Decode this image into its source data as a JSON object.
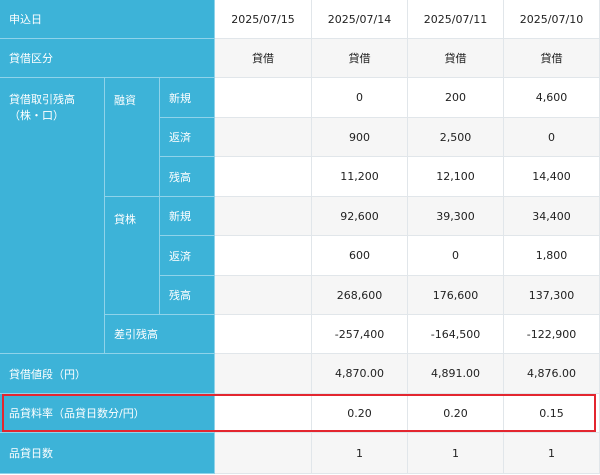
{
  "header": {
    "label": "申込日",
    "dates": [
      "2025/07/15",
      "2025/07/14",
      "2025/07/11",
      "2025/07/10"
    ]
  },
  "rows": {
    "kubun": {
      "label": "貸借区分",
      "values": [
        "貸借",
        "貸借",
        "貸借",
        "貸借"
      ]
    },
    "group_label": "貸借取引残高\n（株・口）",
    "yushi": {
      "label": "融資",
      "shinki": {
        "label": "新規",
        "values": [
          "",
          "0",
          "200",
          "4,600"
        ]
      },
      "hensai": {
        "label": "返済",
        "values": [
          "",
          "900",
          "2,500",
          "0"
        ]
      },
      "zandaka": {
        "label": "残高",
        "values": [
          "",
          "11,200",
          "12,100",
          "14,400"
        ]
      }
    },
    "kashikabu": {
      "label": "貸株",
      "shinki": {
        "label": "新規",
        "values": [
          "",
          "92,600",
          "39,300",
          "34,400"
        ]
      },
      "hensai": {
        "label": "返済",
        "values": [
          "",
          "600",
          "0",
          "1,800"
        ]
      },
      "zandaka": {
        "label": "残高",
        "values": [
          "",
          "268,600",
          "176,600",
          "137,300"
        ]
      }
    },
    "sashihiki": {
      "label": "差引残高",
      "values": [
        "",
        "-257,400",
        "-164,500",
        "-122,900"
      ]
    },
    "nedan": {
      "label": "貸借値段（円）",
      "values": [
        "",
        "4,870.00",
        "4,891.00",
        "4,876.00"
      ]
    },
    "ryoritsu": {
      "label": "品貸料率（品貸日数分/円）",
      "values": [
        "",
        "0.20",
        "0.20",
        "0.15"
      ]
    },
    "nissu": {
      "label": "品貸日数",
      "values": [
        "",
        "1",
        "1",
        "1"
      ]
    }
  }
}
